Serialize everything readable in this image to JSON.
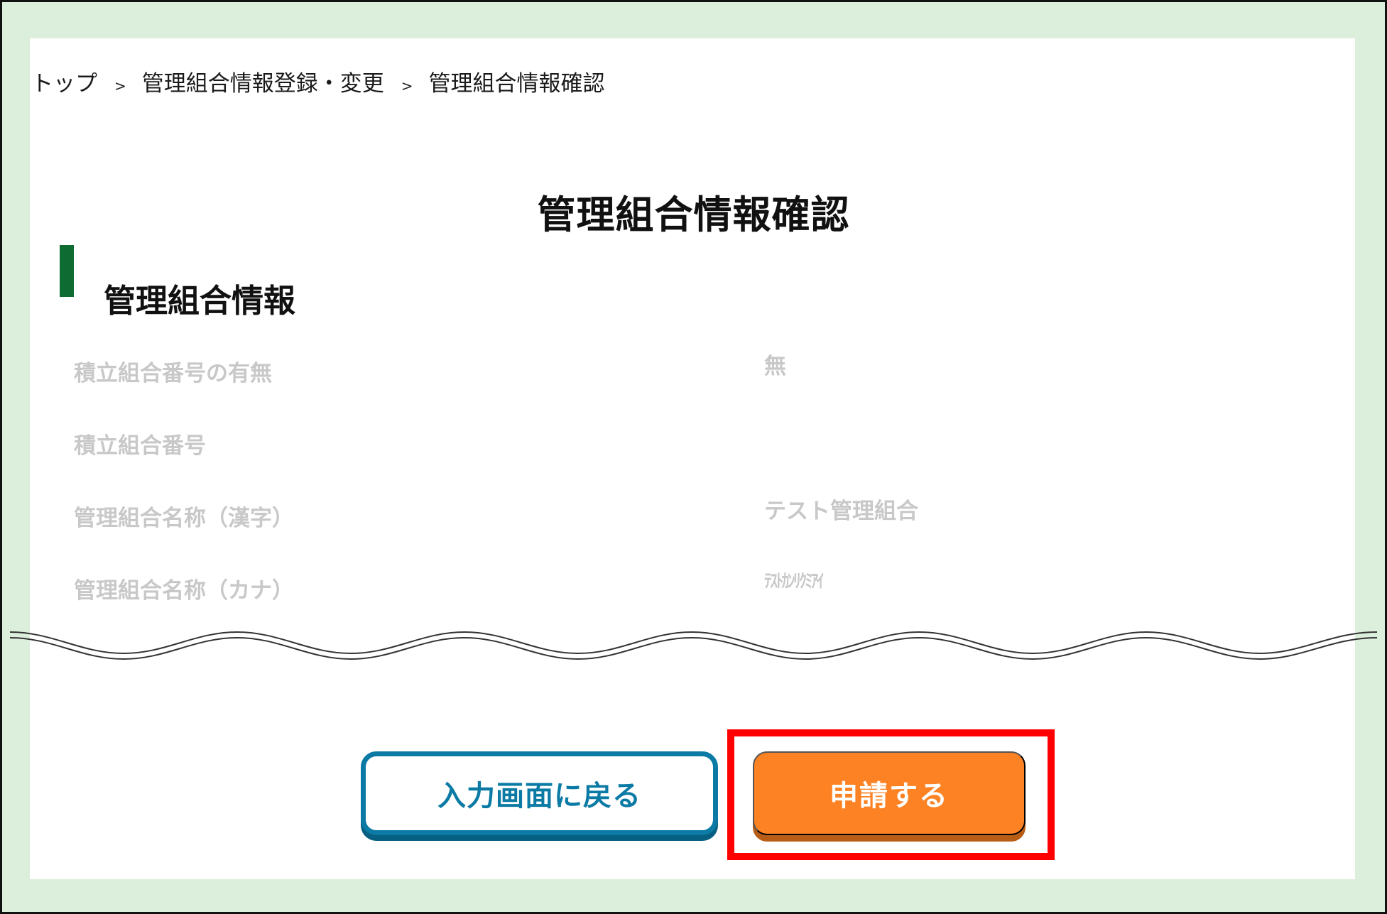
{
  "breadcrumb": {
    "items": [
      "トップ",
      "管理組合情報登録・変更",
      "管理組合情報確認"
    ],
    "separator": ">"
  },
  "page": {
    "title": "管理組合情報確認"
  },
  "section": {
    "title": "管理組合情報",
    "accent_color": "#0e6b32"
  },
  "rows": [
    {
      "label": "積立組合番号の有無",
      "value": "無"
    },
    {
      "label": "積立組合番号",
      "value": ""
    },
    {
      "label": "管理組合名称（漢字）",
      "value": "テスト管理組合"
    },
    {
      "label": "管理組合名称（カナ）",
      "value": "ﾃｽﾄｶﾝﾘｸﾐｱｲ"
    }
  ],
  "actions": {
    "back_label": "入力画面に戻る",
    "apply_label": "申請する",
    "back_color": "#0b7aa4",
    "apply_color": "#fd8224",
    "highlight_color": "#ff0000"
  }
}
